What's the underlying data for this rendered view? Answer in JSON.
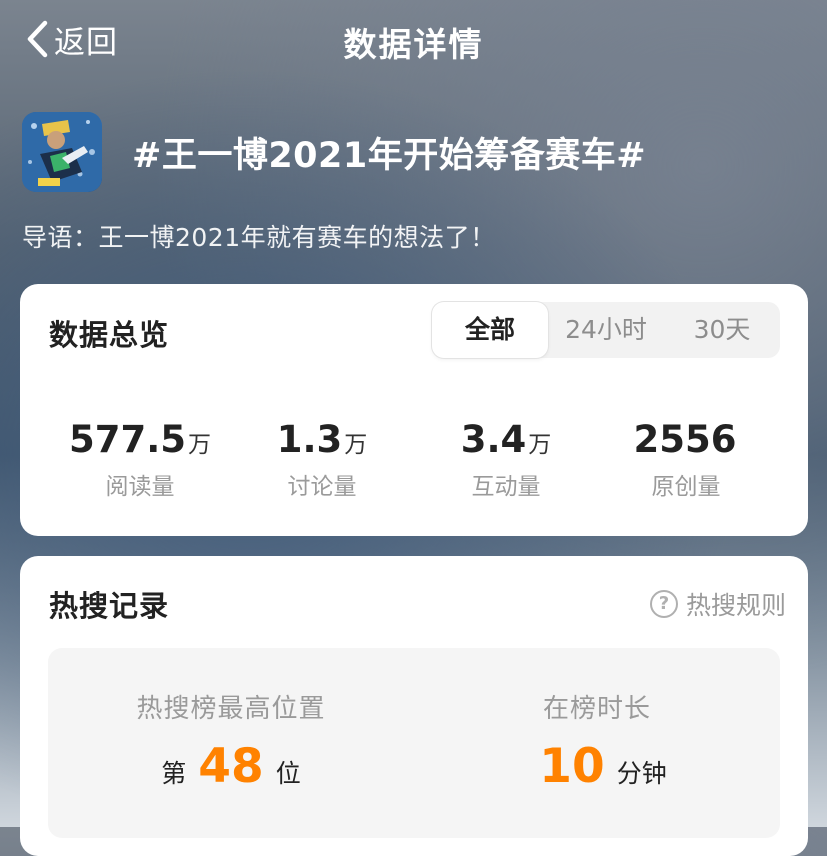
{
  "header": {
    "back_label": "返回",
    "title": "数据详情"
  },
  "topic": {
    "title": "#王一博2021年开始筹备赛车#",
    "intro": "导语：王一博2021年就有赛车的想法了！"
  },
  "overview": {
    "title": "数据总览",
    "tabs": [
      {
        "label": "全部",
        "active": true
      },
      {
        "label": "24小时",
        "active": false
      },
      {
        "label": "30天",
        "active": false
      }
    ],
    "stats": [
      {
        "value": "577.5",
        "unit": "万",
        "label": "阅读量"
      },
      {
        "value": "1.3",
        "unit": "万",
        "label": "讨论量"
      },
      {
        "value": "3.4",
        "unit": "万",
        "label": "互动量"
      },
      {
        "value": "2556",
        "unit": "",
        "label": "原创量"
      }
    ]
  },
  "hot_search": {
    "title": "热搜记录",
    "rule_label": "热搜规则",
    "rule_icon": "question-icon",
    "peak": {
      "label": "热搜榜最高位置",
      "prefix": "第",
      "value": "48",
      "suffix": "位"
    },
    "duration": {
      "label": "在榜时长",
      "value": "10",
      "suffix": "分钟"
    }
  },
  "colors": {
    "accent": "#ff8200",
    "card": "#ffffff",
    "text": "#222222",
    "muted": "#9a9a9a"
  }
}
